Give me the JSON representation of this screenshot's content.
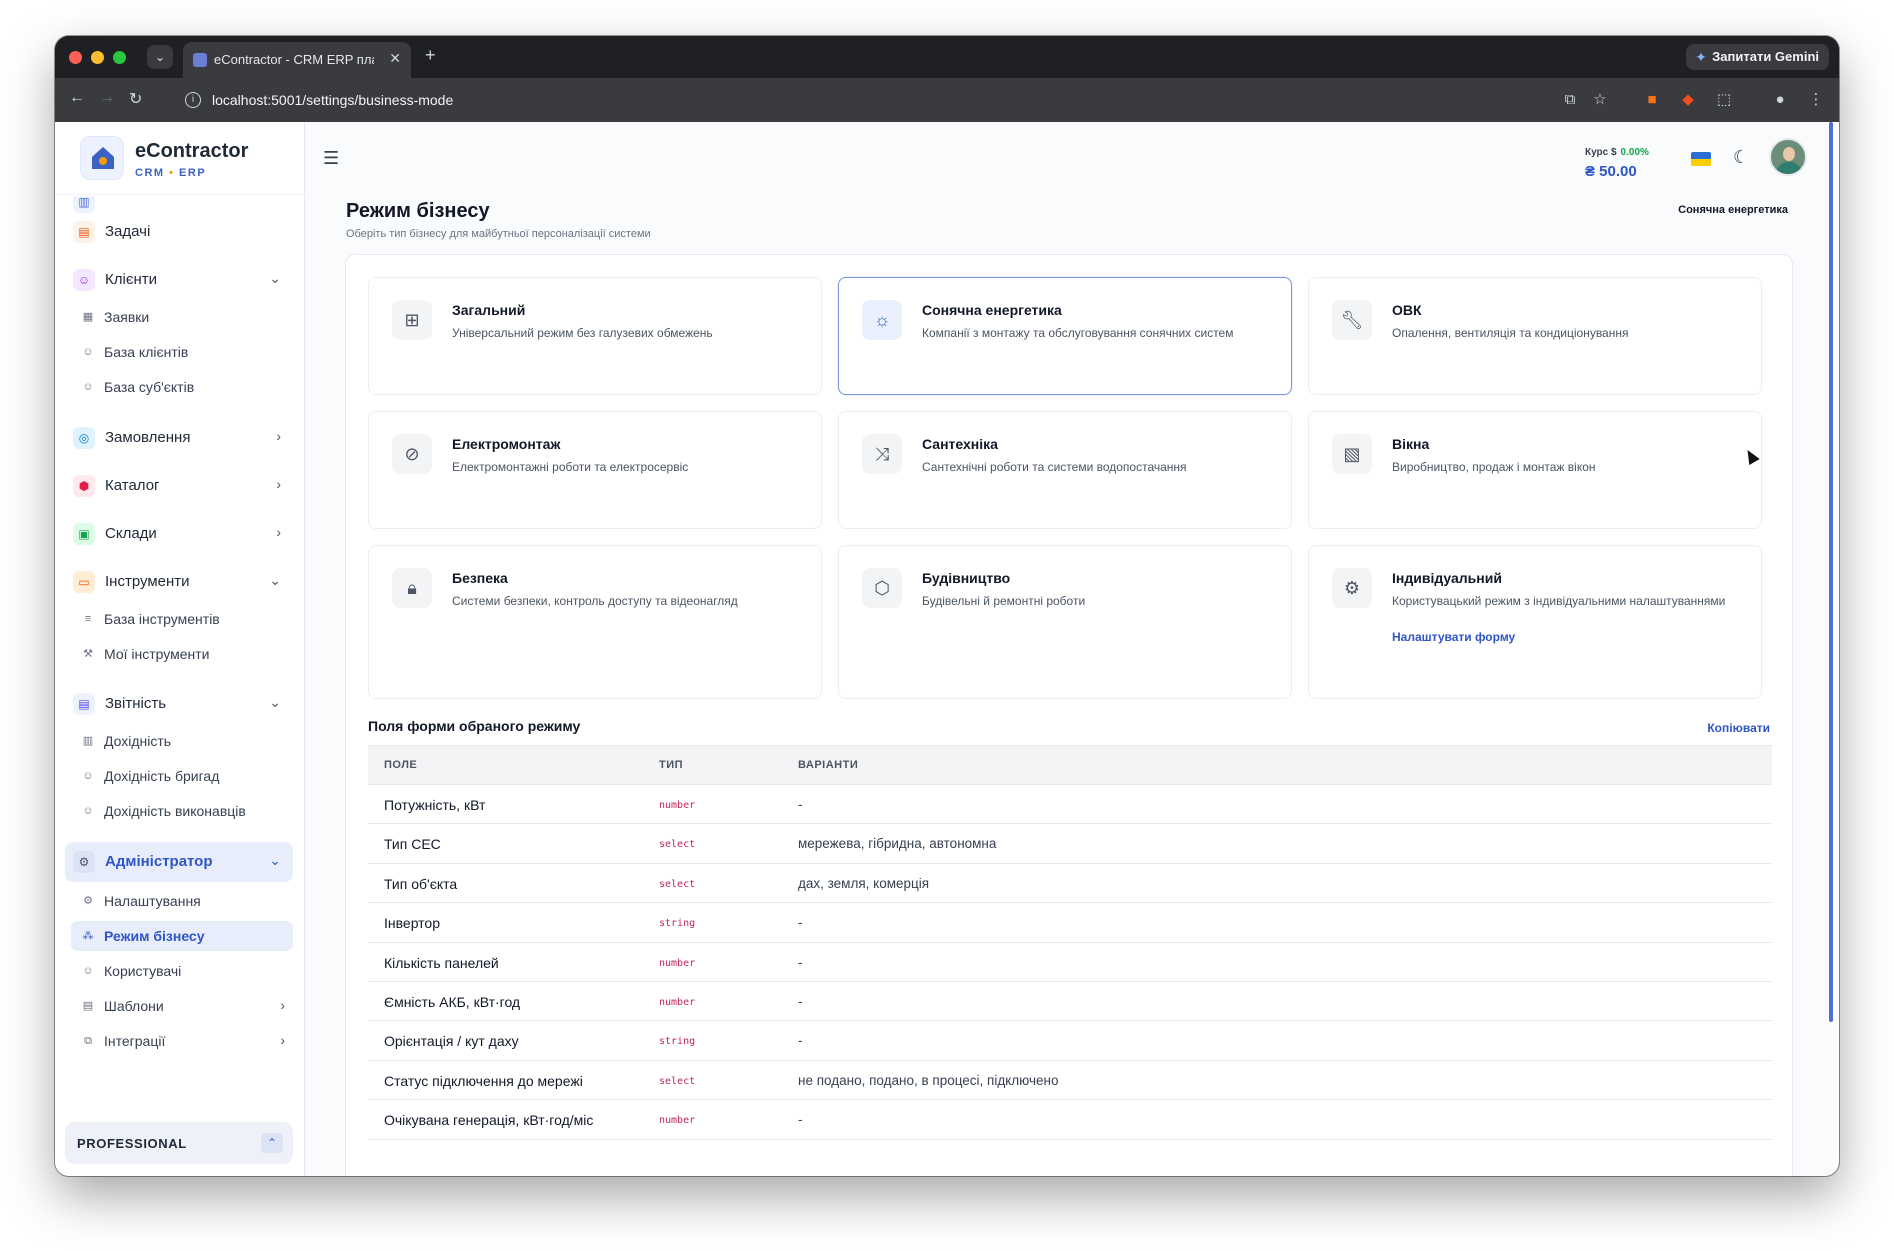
{
  "browser": {
    "tab_title": "eContractor - CRM ERP плат...",
    "tab_close": "✕",
    "new_tab": "+",
    "url": "localhost:5001/settings/business-mode",
    "gemini_label": "Запитати Gemini"
  },
  "brand": {
    "name": "eContractor",
    "sub_left": "CRM",
    "sub_dot": "•",
    "sub_right": "ERP"
  },
  "sidebar": {
    "items": [
      {
        "label": "Задачі"
      },
      {
        "label": "Клієнти"
      },
      {
        "label": "Замовлення"
      },
      {
        "label": "Каталог"
      },
      {
        "label": "Склади"
      },
      {
        "label": "Інструменти"
      },
      {
        "label": "Звітність"
      },
      {
        "label": "Адміністратор"
      }
    ],
    "sub_clients": [
      "Заявки",
      "База клієнтів",
      "База суб'єктів"
    ],
    "sub_tools": [
      "База інструментів",
      "Мої інструменти"
    ],
    "sub_reports": [
      "Дохідність",
      "Дохідність бригад",
      "Дохідність виконавців"
    ],
    "sub_admin": [
      "Налаштування",
      "Режим бізнесу",
      "Користувачі",
      "Шаблони",
      "Інтеграції"
    ],
    "plan": "PROFESSIONAL"
  },
  "header": {
    "rate_label": "Курс $",
    "rate_change": "0.00%",
    "rate_value": "₴ 50.00"
  },
  "page": {
    "title": "Режим бізнесу",
    "subtitle": "Оберіть тип бізнесу для майбутньої персоналізації системи",
    "current_mode": "Сонячна енергетика"
  },
  "modes": [
    {
      "title": "Загальний",
      "desc": "Універсальний режим без галузевих обмежень",
      "icon": "grid-icon"
    },
    {
      "title": "Сонячна енергетика",
      "desc": "Компанії з монтажу та обслуговування сонячних систем",
      "icon": "sun-icon"
    },
    {
      "title": "ОВК",
      "desc": "Опалення, вентиляція та кондиціонування",
      "icon": "wrench-icon"
    },
    {
      "title": "Електромонтаж",
      "desc": "Електромонтажні роботи та електросервіс",
      "icon": "eye-off-icon"
    },
    {
      "title": "Сантехніка",
      "desc": "Сантехнічні роботи та системи водопостачання",
      "icon": "shuffle-icon"
    },
    {
      "title": "Вікна",
      "desc": "Виробництво, продаж і монтаж вікон",
      "icon": "image-icon"
    },
    {
      "title": "Безпека",
      "desc": "Системи безпеки, контроль доступу та відеонагляд",
      "icon": "lock-icon"
    },
    {
      "title": "Будівництво",
      "desc": "Будівельні й ремонтні роботи",
      "icon": "box-icon"
    },
    {
      "title": "Індивідуальний",
      "desc": "Користувацький режим з індивідуальними налаштуваннями",
      "icon": "gear-icon",
      "link": "Налаштувати форму"
    }
  ],
  "fields": {
    "title": "Поля форми обраного режиму",
    "copy_label": "Копіювати",
    "headers": [
      "ПОЛЕ",
      "ТИП",
      "ВАРІАНТИ"
    ],
    "rows": [
      [
        "Потужність, кВт",
        "number",
        "-"
      ],
      [
        "Тип СЕС",
        "select",
        "мережева, гібридна, автономна"
      ],
      [
        "Тип об'єкта",
        "select",
        "дах, земля, комерція"
      ],
      [
        "Інвертор",
        "string",
        "-"
      ],
      [
        "Кількість панелей",
        "number",
        "-"
      ],
      [
        "Ємність АКБ, кВт·год",
        "number",
        "-"
      ],
      [
        "Орієнтація / кут даху",
        "string",
        "-"
      ],
      [
        "Статус підключення до мережі",
        "select",
        "не подано, подано, в процесі, підключено"
      ],
      [
        "Очікувана генерація, кВт·год/міс",
        "number",
        "-"
      ]
    ]
  },
  "colors": {
    "accent": "#2f55c6",
    "type_code": "#c0265c",
    "rate_up": "#16a34a"
  }
}
